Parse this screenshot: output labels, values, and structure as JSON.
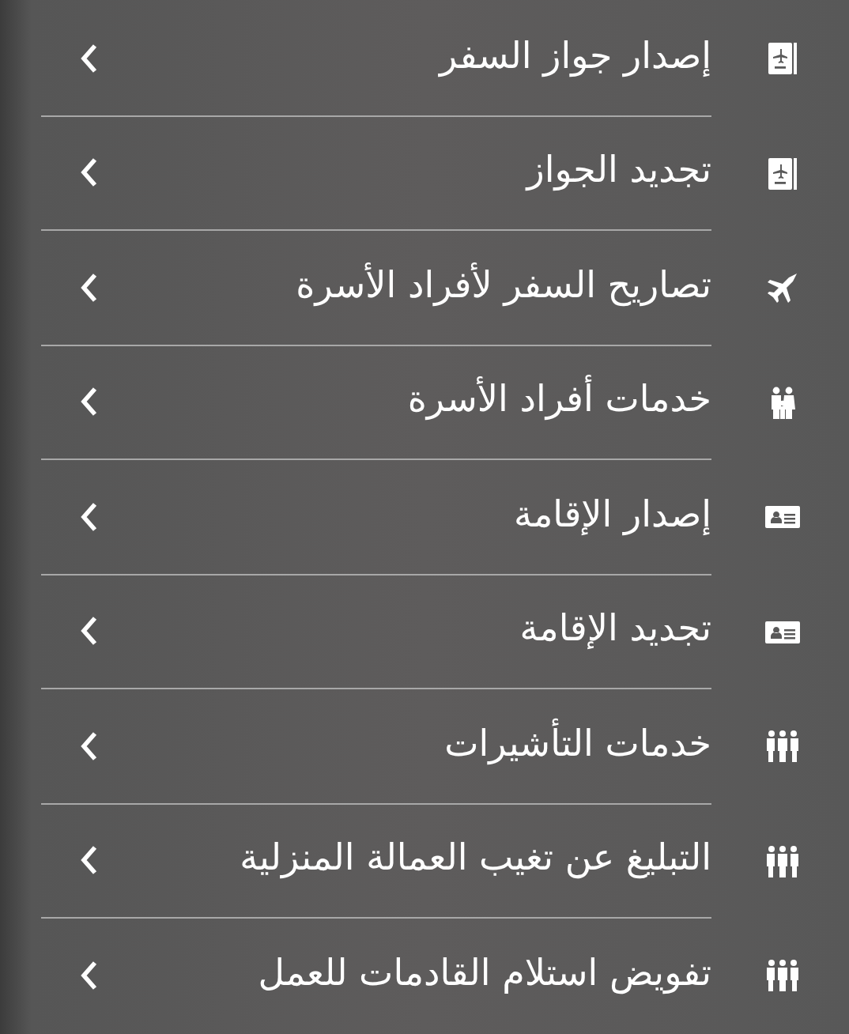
{
  "menu": {
    "items": [
      {
        "label": "إصدار جواز السفر",
        "kind": "passport"
      },
      {
        "label": "تجديد الجواز",
        "kind": "passport"
      },
      {
        "label": "تصاريح السفر لأفراد الأسرة",
        "kind": "plane"
      },
      {
        "label": "خدمات أفراد الأسرة",
        "kind": "family"
      },
      {
        "label": "إصدار الإقامة",
        "kind": "idcard"
      },
      {
        "label": "تجديد الإقامة",
        "kind": "idcard"
      },
      {
        "label": "خدمات التأشيرات",
        "kind": "group"
      },
      {
        "label": "التبليغ عن تغيب العمالة المنزلية",
        "kind": "group"
      },
      {
        "label": "تفويض استلام القادمات للعمل",
        "kind": "group"
      }
    ]
  }
}
